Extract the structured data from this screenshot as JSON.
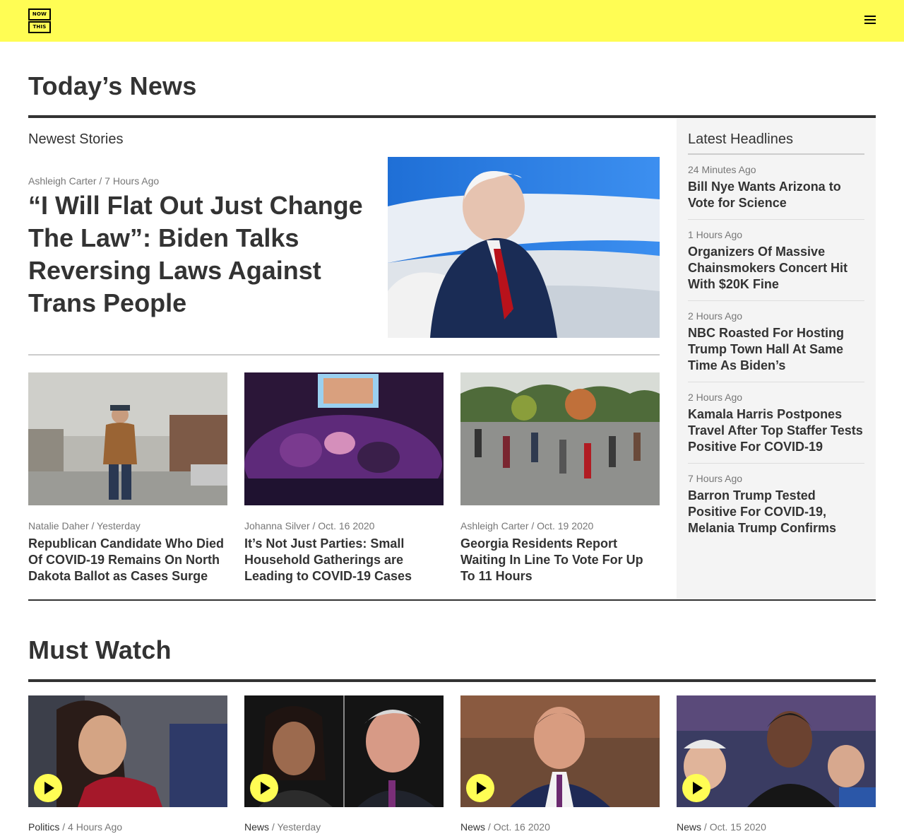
{
  "header": {
    "logo_top": "NOW",
    "logo_bottom": "THIS",
    "accent_color": "#fffd54",
    "menu_icon": "hamburger-menu-icon"
  },
  "todays_news": {
    "title": "Today’s News",
    "newest_label": "Newest Stories",
    "lead": {
      "author": "Ashleigh Carter",
      "time": "7 Hours Ago",
      "title": "“I Will Flat Out Just Change The Law”: Biden Talks Reversing Laws Against Trans People"
    },
    "stories": [
      {
        "author": "Natalie Daher",
        "time": "Yesterday",
        "title": "Republican Candidate Who Died Of COVID-19 Remains On North Dakota Ballot as Cases Surge"
      },
      {
        "author": "Johanna Silver",
        "time": "Oct. 16 2020",
        "title": "It’s Not Just Parties: Small Household Gatherings are Leading to COVID-19 Cases"
      },
      {
        "author": "Ashleigh Carter",
        "time": "Oct. 19 2020",
        "title": "Georgia Residents Report Waiting In Line To Vote For Up To 11 Hours"
      }
    ]
  },
  "latest_headlines": {
    "title": "Latest Headlines",
    "items": [
      {
        "time": "24 Minutes Ago",
        "title": "Bill Nye Wants Arizona to Vote for Science"
      },
      {
        "time": "1 Hours Ago",
        "title": "Organizers Of Massive Chainsmokers Concert Hit With $20K Fine"
      },
      {
        "time": "2 Hours Ago",
        "title": "NBC Roasted For Hosting Trump Town Hall At Same Time As Biden’s"
      },
      {
        "time": "2 Hours Ago",
        "title": "Kamala Harris Postpones Travel After Top Staffer Tests Positive For COVID-19"
      },
      {
        "time": "7 Hours Ago",
        "title": "Barron Trump Tested Positive For COVID-19, Melania Trump Confirms"
      }
    ]
  },
  "must_watch": {
    "title": "Must Watch",
    "videos": [
      {
        "category": "Politics",
        "time": "4 Hours Ago"
      },
      {
        "category": "News",
        "time": "Yesterday"
      },
      {
        "category": "News",
        "time": "Oct. 16 2020"
      },
      {
        "category": "News",
        "time": "Oct. 15 2020"
      }
    ]
  }
}
